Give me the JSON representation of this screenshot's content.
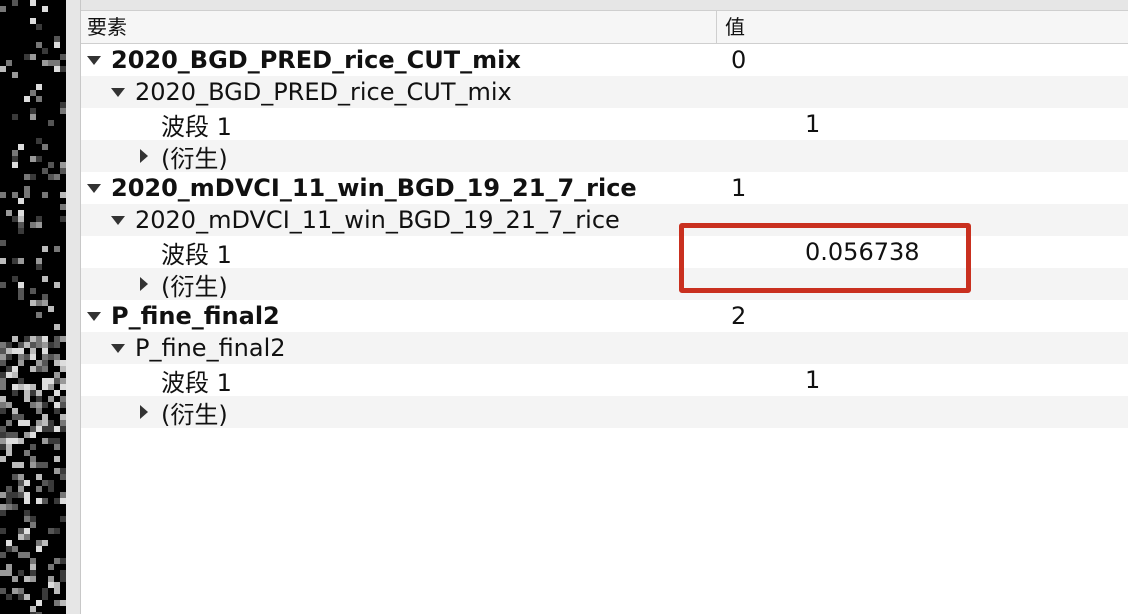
{
  "header": {
    "col_element": "要素",
    "col_value": "值"
  },
  "rows": [
    {
      "label": "2020_BGD_PRED_rice_CUT_mix",
      "value": "0",
      "bold": true
    },
    {
      "label": "2020_BGD_PRED_rice_CUT_mix",
      "value": ""
    },
    {
      "label": "波段 1",
      "value": "1"
    },
    {
      "label": "(衍生)",
      "value": ""
    },
    {
      "label": "2020_mDVCI_11_win_BGD_19_21_7_rice",
      "value": "1",
      "bold": true
    },
    {
      "label": "2020_mDVCI_11_win_BGD_19_21_7_rice",
      "value": ""
    },
    {
      "label": "波段 1",
      "value": "0.056738"
    },
    {
      "label": "(衍生)",
      "value": ""
    },
    {
      "label": "P_fine_final2",
      "value": "2",
      "bold": true
    },
    {
      "label": "P_fine_final2",
      "value": ""
    },
    {
      "label": "波段 1",
      "value": "1"
    },
    {
      "label": "(衍生)",
      "value": ""
    }
  ],
  "colors": {
    "highlight_border": "#c9301f"
  },
  "icons": {
    "expanded": "triangle-down-icon",
    "collapsed": "triangle-right-icon"
  }
}
